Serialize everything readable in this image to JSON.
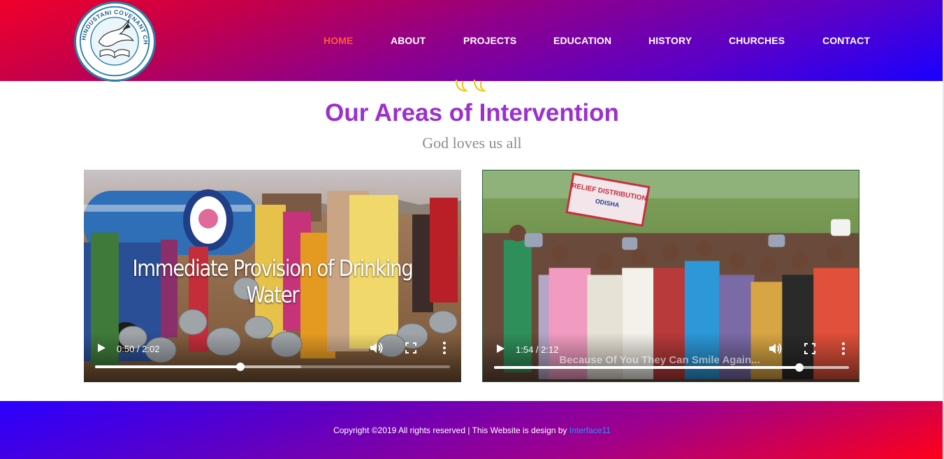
{
  "header": {
    "logo_text": "HINDUSTANI COVENANT CHURCH",
    "nav": [
      {
        "label": "HOME",
        "active": true
      },
      {
        "label": "ABOUT",
        "active": false
      },
      {
        "label": "PROJECTS",
        "active": false
      },
      {
        "label": "EDUCATION",
        "active": false
      },
      {
        "label": "HISTORY",
        "active": false
      },
      {
        "label": "CHURCHES",
        "active": false
      },
      {
        "label": "CONTACT",
        "active": false
      }
    ]
  },
  "section": {
    "title": "Our Areas of Intervention",
    "subtitle": "God loves us all"
  },
  "videos": [
    {
      "overlay_title": "Immediate Provision of Drinking Water",
      "time_display": "0:50 / 2:02",
      "progress_fraction": 0.41,
      "buffered_fraction": 0.58
    },
    {
      "caption": "Because Of You They Can Smile Again...",
      "banner_text": "RELIEF DISTRIBUTION",
      "banner_sub": "ODISHA",
      "time_display": "1:54 / 2:12",
      "progress_fraction": 0.86,
      "buffered_fraction": 1.0
    }
  ],
  "footer": {
    "copyright": "Copyright ©2019 All rights reserved | This Website is design by ",
    "designer_link": "Interface11"
  },
  "colors": {
    "title": "#9b2fd0",
    "active_nav": "#ff5a3c",
    "footer_link": "#2f8fff"
  }
}
